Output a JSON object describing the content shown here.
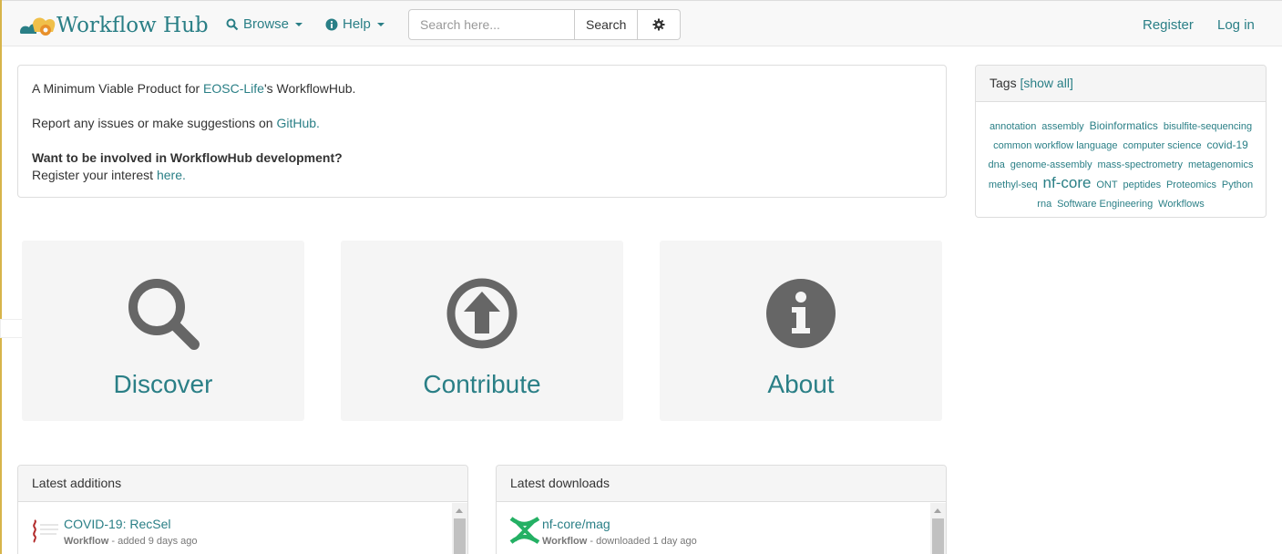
{
  "nav": {
    "brand": "Workflow Hub",
    "browse": "Browse",
    "help": "Help",
    "search_placeholder": "Search here...",
    "search_button": "Search",
    "register": "Register",
    "login": "Log in"
  },
  "notice": {
    "line1_prefix": "A Minimum Viable Product for ",
    "line1_link": "EOSC-Life",
    "line1_suffix": "'s WorkflowHub.",
    "line2_prefix": "Report any issues or make suggestions on ",
    "line2_link": "GitHub.",
    "line3_bold": "Want to be involved in WorkflowHub development?",
    "line4_prefix": "Register your interest ",
    "line4_link": "here."
  },
  "tags": {
    "title": "Tags",
    "show_all": "[show all]",
    "items": [
      {
        "label": "annotation"
      },
      {
        "label": "assembly"
      },
      {
        "label": "Bioinformatics"
      },
      {
        "label": "bisulfite-sequencing"
      },
      {
        "label": "common workflow language"
      },
      {
        "label": "computer science"
      },
      {
        "label": "covid-19"
      },
      {
        "label": "dna"
      },
      {
        "label": "genome-assembly"
      },
      {
        "label": "mass-spectrometry"
      },
      {
        "label": "metagenomics"
      },
      {
        "label": "methyl-seq"
      },
      {
        "label": "nf-core"
      },
      {
        "label": "ONT"
      },
      {
        "label": "peptides"
      },
      {
        "label": "Proteomics"
      },
      {
        "label": "Python"
      },
      {
        "label": "rna"
      },
      {
        "label": "Software Engineering"
      },
      {
        "label": "Workflows"
      }
    ]
  },
  "tiles": {
    "discover": "Discover",
    "contribute": "Contribute",
    "about": "About"
  },
  "latest_additions": {
    "title": "Latest additions",
    "item_title": "COVID-19: RecSel",
    "item_type": "Workflow",
    "item_meta": " - added 9 days ago"
  },
  "latest_downloads": {
    "title": "Latest downloads",
    "item_title": "nf-core/mag",
    "item_type": "Workflow",
    "item_meta": " - downloaded 1 day ago"
  },
  "colors": {
    "link": "#2a7f86",
    "icon_grey": "#666666",
    "tile_bg": "#f5f5f5",
    "logo_orange": "#f0a830",
    "nfcore_green": "#24b064"
  }
}
